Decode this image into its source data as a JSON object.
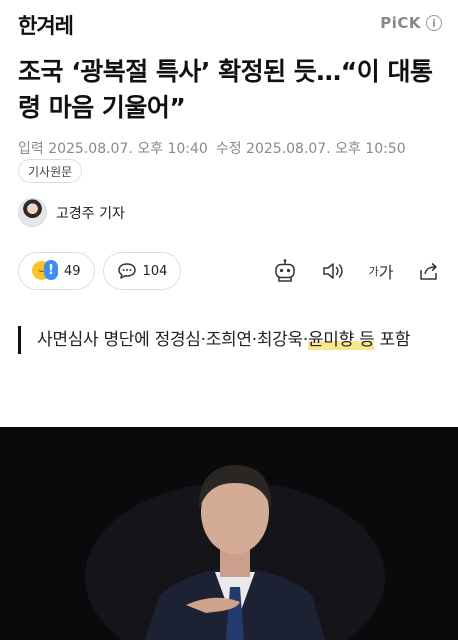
{
  "header": {
    "logo": "한겨레",
    "pick_label": "PiCK",
    "info_glyph": "i"
  },
  "article": {
    "headline": "조국 ‘광복절 특사’ 확정된 듯…“이 대통령 마음 기울어”",
    "published": "입력 2025.08.07. 오후 10:40",
    "modified": "수정 2025.08.07. 오후 10:50",
    "source_badge": "기사원문",
    "author": "고경주 기자",
    "subhead_before": "사면심사 명단에 정경심·조희연·최강욱·",
    "subhead_highlight": "윤미향 등",
    "subhead_after": " 포함"
  },
  "reactions": {
    "reaction_count": "49",
    "comment_count": "104",
    "emoji_badge": "!"
  },
  "toolbar": {
    "icons": [
      "robot-summary-icon",
      "speaker-icon",
      "font-size-icon",
      "share-icon"
    ],
    "font_size_small": "가",
    "font_size_large": "가"
  },
  "colors": {
    "highlight": "#fbe68d",
    "photo_background": "#0a0a0c",
    "accent_blue": "#3a8ef5"
  }
}
